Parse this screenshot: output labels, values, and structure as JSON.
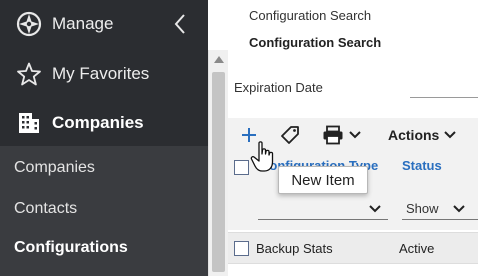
{
  "sidebar": {
    "items": [
      {
        "label": "Manage",
        "icon": "compass-icon"
      },
      {
        "label": "My Favorites",
        "icon": "star-icon"
      },
      {
        "label": "Companies",
        "icon": "building-icon"
      }
    ],
    "collapse_icon": "chevron-left-icon",
    "submenu": [
      {
        "label": "Companies"
      },
      {
        "label": "Contacts"
      },
      {
        "label": "Configurations"
      }
    ]
  },
  "main": {
    "breadcrumb": "Configuration Search",
    "title": "Configuration Search",
    "filter_label": "Expiration Date",
    "toolbar": {
      "actions_label": "Actions",
      "tooltip": "New Item"
    },
    "table": {
      "columns": [
        "Configuration Type",
        "Status"
      ],
      "filter_status": "Show",
      "rows": [
        {
          "type": "Backup Stats",
          "status": "Active"
        }
      ]
    }
  },
  "colors": {
    "sidebar_bg": "#2b2d31",
    "submenu_bg": "#3a3c40",
    "accent_blue": "#2a6fbf",
    "toolbar_bg": "#f2f2f2"
  }
}
